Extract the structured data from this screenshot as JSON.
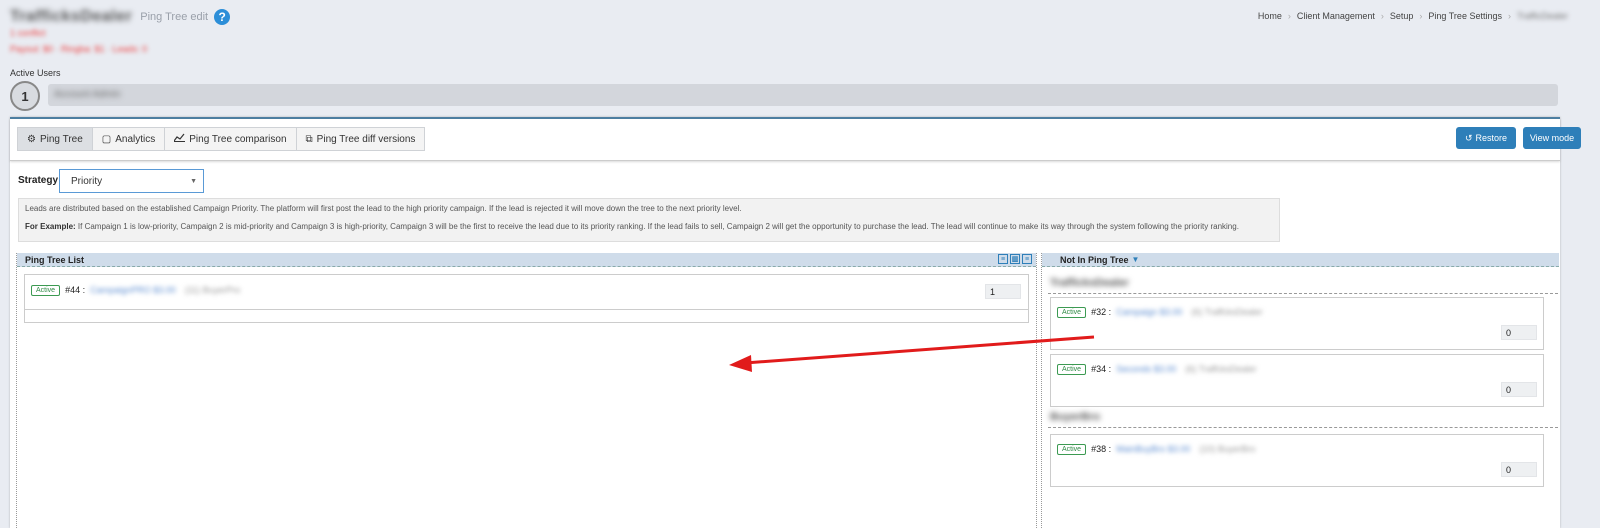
{
  "header": {
    "client_name": "TrafficksDealer",
    "page_subtitle": "Ping Tree edit",
    "help_icon": "question-circle-icon",
    "red_line1": "1 conflict",
    "red_line2": "Payout: $0 · Ringba: $1 · Leads: 0"
  },
  "breadcrumb": {
    "items": [
      "Home",
      "Client Management",
      "Setup",
      "Ping Tree Settings",
      "TrafficDealer"
    ]
  },
  "active_users": {
    "label": "Active Users",
    "count": "1",
    "user_name": "Account Admin"
  },
  "tabs": [
    {
      "label": "Ping Tree",
      "icon": "gears-icon"
    },
    {
      "label": "Analytics",
      "icon": "calendar-icon"
    },
    {
      "label": "Ping Tree comparison",
      "icon": "line-chart-icon"
    },
    {
      "label": "Ping Tree diff versions",
      "icon": "clone-icon"
    }
  ],
  "buttons": {
    "restore": "Restore",
    "view_mode": "View mode"
  },
  "strategy": {
    "label": "Strategy",
    "value": "Priority"
  },
  "info": {
    "line1": "Leads are distributed based on the established Campaign Priority. The platform will first post the lead to the high priority campaign. If the lead is rejected it will move down the tree to the next priority level.",
    "example_label": "For Example:",
    "line2": " If Campaign 1 is low-priority, Campaign 2 is mid-priority and Campaign 3 is high-priority, Campaign 3 will be the first to receive the lead due to its priority ranking. If the lead fails to sell, Campaign 2 will get the opportunity to purchase the lead. The lead will continue to make its way through the system following the priority ranking."
  },
  "ping_tree_list": {
    "title": "Ping Tree List",
    "items": [
      {
        "status": "Active",
        "id": "#44 :",
        "name": "CampaignPRO $3.00",
        "extra": "(11) BuyerPro",
        "priority": "1"
      }
    ]
  },
  "not_in_ping_tree": {
    "title": "Not In Ping Tree",
    "groups": [
      {
        "name": "TrafficksDealer",
        "items": [
          {
            "status": "Active",
            "id": "#32 :",
            "name": "Campaign $3.00",
            "extra": "(6) TraffcksDealer",
            "priority": "0"
          },
          {
            "status": "Active",
            "id": "#34 :",
            "name": "Seconds $3.00",
            "extra": "(6) TraffcksDealer",
            "priority": "0"
          }
        ]
      },
      {
        "name": "BuyerBro",
        "items": [
          {
            "status": "Active",
            "id": "#38 :",
            "name": "MainBuyBro $3.00",
            "extra": "(10) BuyerBro",
            "priority": "0"
          }
        ]
      }
    ]
  },
  "colors": {
    "accent": "#2e7fb9",
    "active_badge": "#3c9a52",
    "arrow": "#e11b1b",
    "panel_header": "#cfdcea"
  }
}
